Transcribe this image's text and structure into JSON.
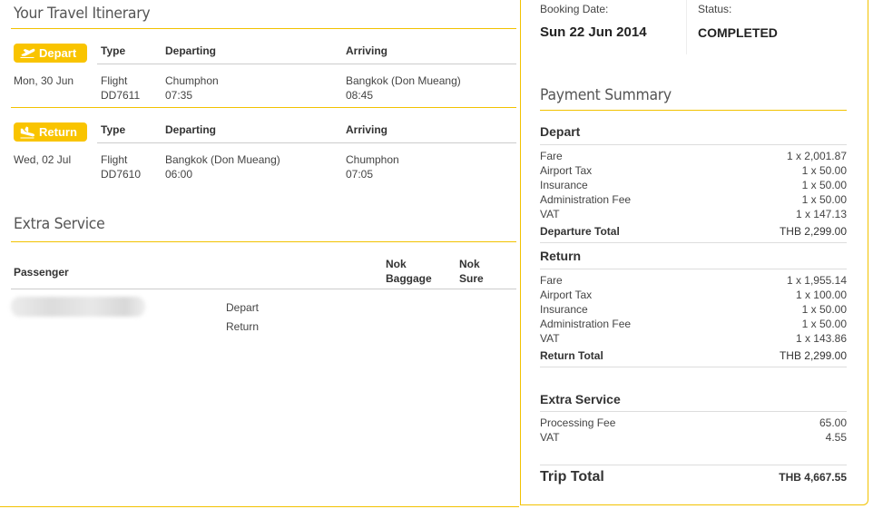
{
  "itinerary": {
    "title": "Your Travel Itinerary",
    "col_type": "Type",
    "col_departing": "Departing",
    "col_arriving": "Arriving",
    "depart": {
      "badge": "Depart",
      "date": "Mon, 30 Jun",
      "type": "Flight",
      "flight_no": "DD7611",
      "from": "Chumphon",
      "dep_time": "07:35",
      "to": "Bangkok (Don Mueang)",
      "arr_time": "08:45"
    },
    "return": {
      "badge": "Return",
      "date": "Wed, 02 Jul",
      "type": "Flight",
      "flight_no": "DD7610",
      "from": "Bangkok (Don Mueang)",
      "dep_time": "06:00",
      "to": "Chumphon",
      "arr_time": "07:05"
    }
  },
  "extra_service": {
    "title": "Extra Service",
    "col_passenger": "Passenger",
    "col_baggage_1": "Nok",
    "col_baggage_2": "Baggage",
    "col_sure_1": "Nok",
    "col_sure_2": "Sure",
    "row_depart": "Depart",
    "row_return": "Return"
  },
  "booking": {
    "date_label": "Booking Date:",
    "date_value": "Sun 22 Jun 2014",
    "status_label": "Status:",
    "status_value": "COMPLETED"
  },
  "payment": {
    "title": "Payment Summary",
    "depart": {
      "title": "Depart",
      "rows": [
        {
          "label": "Fare",
          "value": "1 x 2,001.87"
        },
        {
          "label": "Airport Tax",
          "value": "1 x 50.00"
        },
        {
          "label": "Insurance",
          "value": "1 x 50.00"
        },
        {
          "label": "Administration Fee",
          "value": "1 x 50.00"
        },
        {
          "label": "VAT",
          "value": "1 x 147.13"
        }
      ],
      "total_label": "Departure Total",
      "total_value": "THB  2,299.00"
    },
    "return": {
      "title": "Return",
      "rows": [
        {
          "label": "Fare",
          "value": "1 x 1,955.14"
        },
        {
          "label": "Airport Tax",
          "value": "1 x 100.00"
        },
        {
          "label": "Insurance",
          "value": "1 x 50.00"
        },
        {
          "label": "Administration Fee",
          "value": "1 x 50.00"
        },
        {
          "label": "VAT",
          "value": "1 x 143.86"
        }
      ],
      "total_label": "Return Total",
      "total_value": "THB  2,299.00"
    },
    "extra": {
      "title": "Extra Service",
      "rows": [
        {
          "label": "Processing Fee",
          "value": "65.00"
        },
        {
          "label": "VAT",
          "value": "4.55"
        }
      ]
    },
    "trip_total_label": "Trip Total",
    "trip_total_value": "THB 4,667.55"
  },
  "colors": {
    "accent": "#f9c400",
    "border": "#f2c200"
  },
  "icons": {
    "depart": "plane-takeoff-icon",
    "return": "plane-landing-icon"
  }
}
